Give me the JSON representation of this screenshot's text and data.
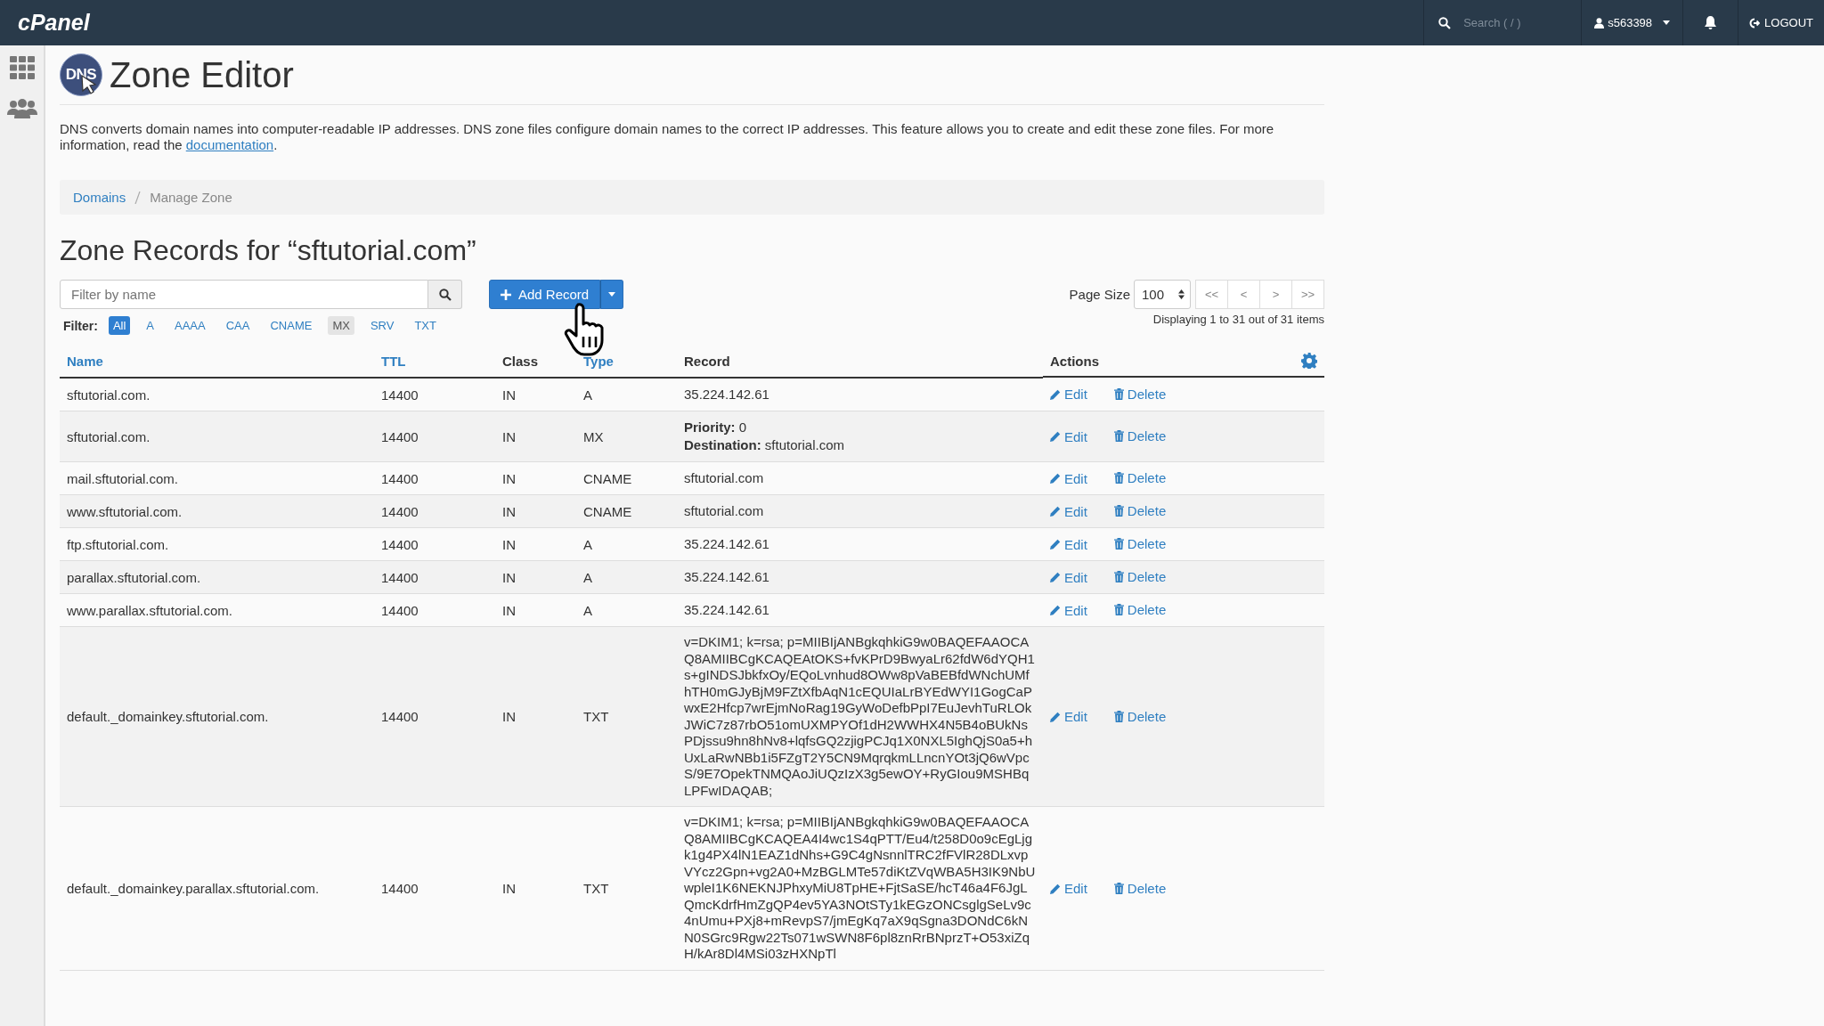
{
  "topbar": {
    "logo": "cPanel",
    "search": {
      "placeholder": "Search ( / )"
    },
    "user": "s563398",
    "logout": "LOGOUT"
  },
  "page": {
    "title": "Zone Editor",
    "logo_text": "DNS",
    "description": "DNS converts domain names into computer-readable IP addresses. DNS zone files configure domain names to the correct IP addresses. This feature allows you to create and edit these zone files. For more information, read the ",
    "description_link": "documentation",
    "description_end": "."
  },
  "breadcrumb": [
    {
      "label": "Domains",
      "link": true
    },
    {
      "label": "Manage Zone",
      "link": false
    }
  ],
  "section_title": "Zone Records for “sftutorial.com”",
  "filter_field": {
    "placeholder": "Filter by name"
  },
  "add_button": "Add Record",
  "page_size": {
    "label": "Page Size",
    "value": "100"
  },
  "pager": [
    "<<",
    "<",
    ">",
    ">>"
  ],
  "display_info": "Displaying 1 to 31 out of 31 items",
  "filter": {
    "label": "Filter:",
    "options": [
      {
        "label": "All",
        "selected": true,
        "highlighted": false
      },
      {
        "label": "A",
        "selected": false,
        "highlighted": false
      },
      {
        "label": "AAAA",
        "selected": false,
        "highlighted": false
      },
      {
        "label": "CAA",
        "selected": false,
        "highlighted": false
      },
      {
        "label": "CNAME",
        "selected": false,
        "highlighted": false
      },
      {
        "label": "MX",
        "selected": false,
        "highlighted": true
      },
      {
        "label": "SRV",
        "selected": false,
        "highlighted": false
      },
      {
        "label": "TXT",
        "selected": false,
        "highlighted": false
      }
    ]
  },
  "table": {
    "columns": [
      {
        "label": "Name",
        "sortable": true
      },
      {
        "label": "TTL",
        "sortable": true
      },
      {
        "label": "Class",
        "sortable": false
      },
      {
        "label": "Type",
        "sortable": true
      },
      {
        "label": "Record",
        "sortable": false
      },
      {
        "label": "Actions",
        "sortable": false
      }
    ],
    "rows": [
      {
        "name": "sftutorial.com.",
        "ttl": "14400",
        "class": "IN",
        "type": "A",
        "kind": "plain",
        "record": [
          "35.224.142.61"
        ],
        "edit": "Edit",
        "delete": "Delete"
      },
      {
        "name": "sftutorial.com.",
        "ttl": "14400",
        "class": "IN",
        "type": "MX",
        "kind": "plain",
        "record": [
          "**Priority:** 0",
          "**Destination:** sftutorial.com"
        ],
        "edit": "Edit",
        "delete": "Delete"
      },
      {
        "name": "mail.sftutorial.com.",
        "ttl": "14400",
        "class": "IN",
        "type": "CNAME",
        "kind": "plain",
        "record": [
          "sftutorial.com"
        ],
        "edit": "Edit",
        "delete": "Delete"
      },
      {
        "name": "www.sftutorial.com.",
        "ttl": "14400",
        "class": "IN",
        "type": "CNAME",
        "kind": "plain",
        "record": [
          "sftutorial.com"
        ],
        "edit": "Edit",
        "delete": "Delete"
      },
      {
        "name": "ftp.sftutorial.com.",
        "ttl": "14400",
        "class": "IN",
        "type": "A",
        "kind": "plain",
        "record": [
          "35.224.142.61"
        ],
        "edit": "Edit",
        "delete": "Delete"
      },
      {
        "name": "parallax.sftutorial.com.",
        "ttl": "14400",
        "class": "IN",
        "type": "A",
        "kind": "plain",
        "record": [
          "35.224.142.61"
        ],
        "edit": "Edit",
        "delete": "Delete"
      },
      {
        "name": "www.parallax.sftutorial.com.",
        "ttl": "14400",
        "class": "IN",
        "type": "A",
        "kind": "plain",
        "record": [
          "35.224.142.61"
        ],
        "edit": "Edit",
        "delete": "Delete"
      },
      {
        "name": "default._domainkey.sftutorial.com.",
        "ttl": "14400",
        "class": "IN",
        "type": "TXT",
        "kind": "long",
        "edit": "Edit",
        "delete": "Delete",
        "record": [
          "v=DKIM1; k=rsa; p=MIIBIjANBgkqhkiG9w0BAQEFAAOCAQ8AMIIBCgKCAQEAtOKS+fvKPrD9BwyaLr62fdW6dYQH1s+gINDSJbkfxOy/EQoLvnhud8OWw8pVaBEBfdWNchUMfhTH0mGJyBjM9FZtXfbAqN1cEQUIaLrBYEdWYI1GogCaPwxE2Hfcp7wrEjmNoRag19GyWoDefbPpI7EuJevhTuRLOkJWiC7z87rbO51omUXMPYOf1dH2WWHX4N5B4oBUkNsPDjssu9hn8hNv8+lqfsGQ2zjigPCJq1X0NXL5IghQjS0a5+hUxLaRwNBb1i5FZgT2Y5CN9MqrqkmLLncnYOt3jQ6wVpcS/9E7OpekTNMQAoJiUQzIzX3g5ewOY+RyGIou9MSHBqLPFwIDAQAB;"
        ]
      },
      {
        "name": "default._domainkey.parallax.sftutorial.com.",
        "ttl": "14400",
        "class": "IN",
        "type": "TXT",
        "kind": "long",
        "edit": "Edit",
        "delete": "Delete",
        "record": [
          "v=DKIM1; k=rsa; p=MIIBIjANBgkqhkiG9w0BAQEFAAOCAQ8AMIIBCgKCAQEA4I4wc1S4qPTT/Eu4/t258D0o9cEgLjgk1g4PX4lN1EAZ1dNhs+G9C4gNsnnlTRC2fFVlR28DLxvpVYcz2Gpn+vg2A0+MzBGLMTe57diKtZVqWBA5H3IK9NbUwpleI1K6NEKNJPhxyMiU8TpHE+FjtSaSE/hcT46a4F6JgLQmcKdrfHmZgQP4ev5YA3NOtSTy1kEGzONCsglgSeLv9c4nUmu+PXj8+mRevpS7/jmEgKq7aX9qSgna3DONdC6kNN0SGrc9Rgw22Ts071wSWN8F6pl8znRrBNprzT+O53xiZqH/kAr8Dl4MSi03zHXNpTl"
        ]
      }
    ]
  }
}
